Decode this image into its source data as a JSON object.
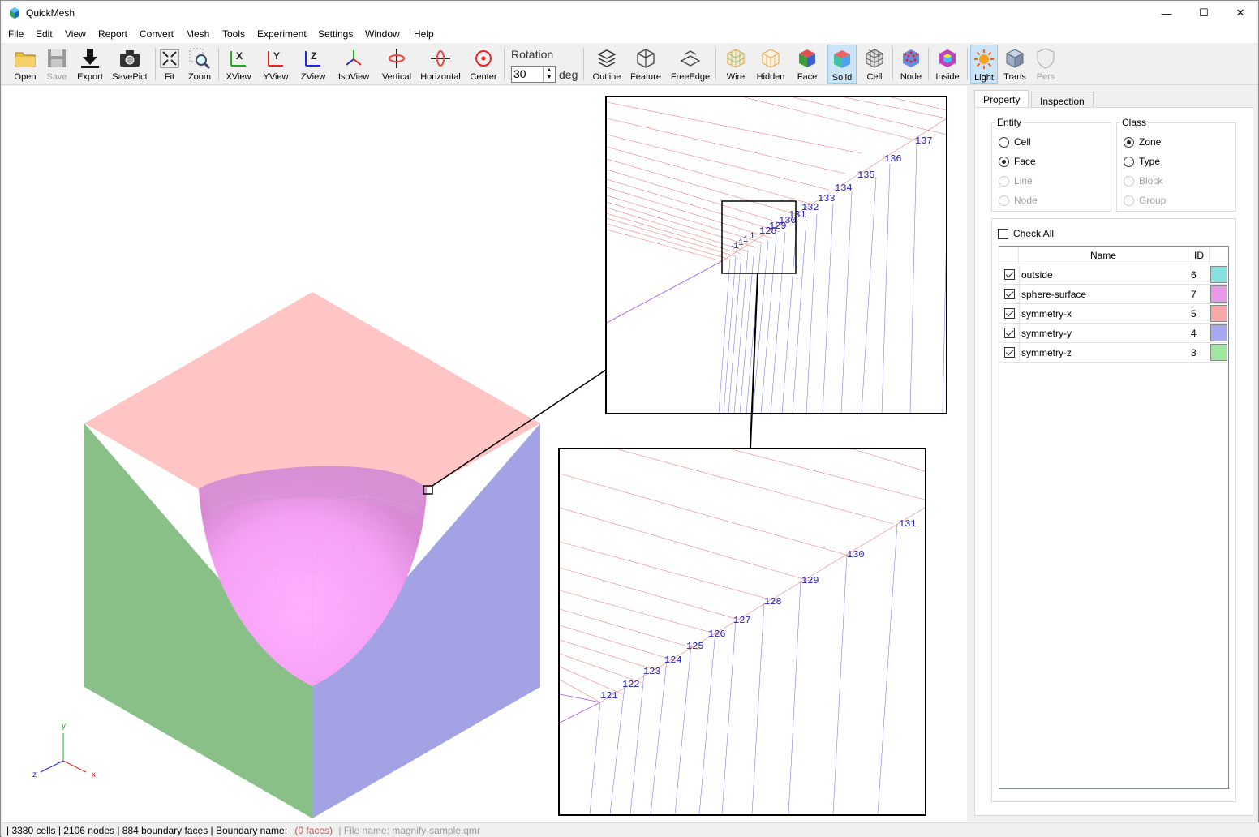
{
  "app": {
    "title": "QuickMesh",
    "minimize": "—",
    "maximize": "☐",
    "close": "✕"
  },
  "menu": [
    "File",
    "Edit",
    "View",
    "Report",
    "Convert",
    "Mesh",
    "Tools",
    "Experiment",
    "Settings",
    "Window",
    "Help"
  ],
  "toolbar": {
    "open": "Open",
    "save": "Save",
    "export": "Export",
    "savepict": "SavePict",
    "fit": "Fit",
    "zoom": "Zoom",
    "xview": "XView",
    "yview": "YView",
    "zview": "ZView",
    "isoview": "IsoView",
    "vertical": "Vertical",
    "horizontal": "Horizontal",
    "center": "Center",
    "rotation_label": "Rotation",
    "rotation_value": "30",
    "rotation_unit": "deg",
    "outline": "Outline",
    "feature": "Feature",
    "freeedge": "FreeEdge",
    "wire": "Wire",
    "hidden": "Hidden",
    "face": "Face",
    "solid": "Solid",
    "cell": "Cell",
    "node": "Node",
    "inside": "Inside",
    "light": "Light",
    "trans": "Trans",
    "pers": "Pers"
  },
  "viewport": {
    "axis": {
      "x": "x",
      "y": "y",
      "z": "z"
    },
    "colors": {
      "top": "#ffc4c4",
      "left": "#88c088",
      "right": "#a2a2e4",
      "sphere": "#f29bf2",
      "sphere_light": "#ffaaff"
    },
    "magnifier1_labels": [
      "137",
      "136",
      "135",
      "134",
      "133",
      "132",
      "131",
      "130",
      "129",
      "128"
    ],
    "magnifier2_labels": [
      "131",
      "130",
      "129",
      "128",
      "127",
      "126",
      "125",
      "124",
      "123",
      "122",
      "121"
    ]
  },
  "panel": {
    "tabs": [
      "Property",
      "Inspection"
    ],
    "entity": {
      "title": "Entity",
      "options": [
        "Cell",
        "Face",
        "Line",
        "Node"
      ],
      "selected": "Face"
    },
    "class": {
      "title": "Class",
      "options": [
        "Zone",
        "Type",
        "Block",
        "Group"
      ],
      "selected": "Zone"
    },
    "check_all": "Check All",
    "table": {
      "headers": [
        "Name",
        "ID"
      ],
      "rows": [
        {
          "name": "outside",
          "id": "6",
          "color": "#88e0e0"
        },
        {
          "name": "sphere-surface",
          "id": "7",
          "color": "#e89ae8"
        },
        {
          "name": "symmetry-x",
          "id": "5",
          "color": "#f8a8a8"
        },
        {
          "name": "symmetry-y",
          "id": "4",
          "color": "#a8a8f0"
        },
        {
          "name": "symmetry-z",
          "id": "3",
          "color": "#a0e8a0"
        }
      ]
    }
  },
  "status": {
    "main": "| 3380 cells | 2106 nodes | 884 boundary faces |  Boundary name:",
    "boundary": "(0 faces)",
    "file": "| File name: magnify-sample.qmr"
  }
}
